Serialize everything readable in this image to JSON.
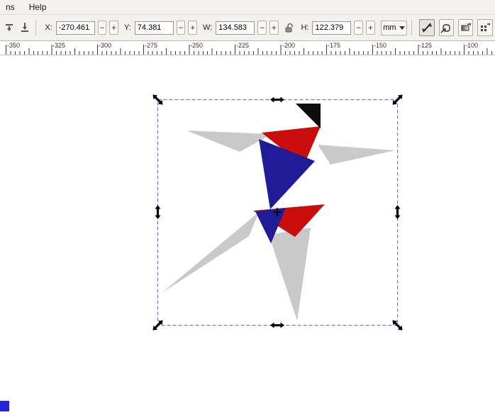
{
  "menu": {
    "items": [
      {
        "label": "ns"
      },
      {
        "label": "Help"
      }
    ]
  },
  "toolbar": {
    "fields": {
      "x": {
        "label": "X:",
        "value": "-270.461"
      },
      "y": {
        "label": "Y:",
        "value": "74.381"
      },
      "w": {
        "label": "W:",
        "value": "134.583"
      },
      "h": {
        "label": "H:",
        "value": "122.379"
      }
    },
    "stepper": {
      "minus": "−",
      "plus": "+"
    },
    "units": {
      "value": "mm"
    }
  },
  "ruler": {
    "labels": [
      "-350",
      "-325",
      "-300",
      "-275",
      "-250",
      "-225",
      "-200",
      "-175",
      "-150",
      "-125",
      "-100"
    ]
  },
  "icons": {
    "lower-one-step": "stack-with-down-arrow",
    "lower-to-bottom": "down-arrow-to-bar",
    "lock-ratio": "open-padlock",
    "dropdown-caret": "▾",
    "scale-stroke": "diagonal-double-arrow",
    "scale-corners": "rounded-rect-with-arrow",
    "move-gradients": "gradient-square-with-arrow",
    "move-patterns": "dot-grid-with-arrow",
    "selection-handle": "double-headed-arrow",
    "rotation-center": "crosshair-plus"
  },
  "figure": {
    "red": "#c90d0d",
    "navy": "#211b98",
    "gray": "#c9c9c9",
    "black": "#0d0d0d"
  },
  "selection": {
    "stroke_color": "#6a6adf",
    "handle_color": "#000000",
    "center_color": "#000000"
  },
  "palette": {
    "fill_swatch": "#2424df"
  }
}
